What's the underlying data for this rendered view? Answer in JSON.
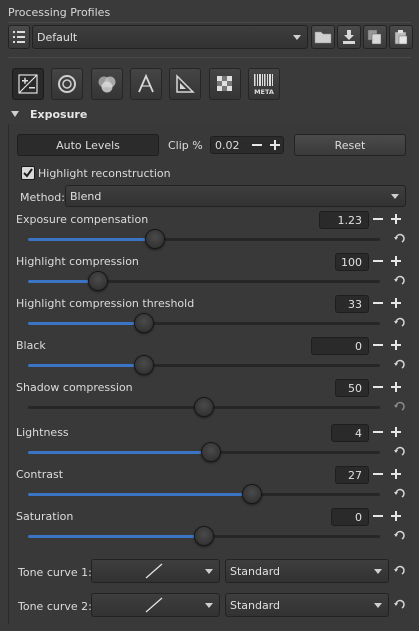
{
  "profiles": {
    "title": "Processing Profiles",
    "selected": "Default"
  },
  "tabs": [
    {
      "name": "exposure-tab",
      "icon": "exposure-icon"
    },
    {
      "name": "detail-tab",
      "icon": "detail-icon"
    },
    {
      "name": "color-tab",
      "icon": "color-icon"
    },
    {
      "name": "advanced-tab",
      "icon": "advanced-icon"
    },
    {
      "name": "transform-tab",
      "icon": "transform-icon"
    },
    {
      "name": "raw-tab",
      "icon": "raw-icon"
    },
    {
      "name": "metadata-tab",
      "icon": "metadata-icon",
      "label": "META"
    }
  ],
  "exposure": {
    "title": "Exposure",
    "auto_levels": "Auto Levels",
    "clip_label": "Clip %",
    "clip_value": "0.02",
    "reset": "Reset",
    "highlight_reconstruction": "Highlight reconstruction",
    "highlight_reconstruction_checked": true,
    "method_label": "Method:",
    "method_value": "Blend",
    "sliders": [
      {
        "label": "Exposure compensation",
        "value": "1.23",
        "fraction": 0.36
      },
      {
        "label": "Highlight compression",
        "value": "100",
        "fraction": 0.2
      },
      {
        "label": "Highlight compression threshold",
        "value": "33",
        "fraction": 0.33
      },
      {
        "label": "Black",
        "value": "0",
        "fraction": 0.33
      },
      {
        "label": "Shadow compression",
        "value": "50",
        "fraction": 0.5
      },
      {
        "label": "Lightness",
        "value": "4",
        "fraction": 0.52
      },
      {
        "label": "Contrast",
        "value": "27",
        "fraction": 0.635
      },
      {
        "label": "Saturation",
        "value": "0",
        "fraction": 0.5
      }
    ],
    "tone_curve_1_label": "Tone curve 1:",
    "tone_curve_1_mode": "Standard",
    "tone_curve_2_label": "Tone curve 2:",
    "tone_curve_2_mode": "Standard"
  },
  "colors": {
    "background": "#3a3a3a",
    "accent": "#3b74c4"
  }
}
